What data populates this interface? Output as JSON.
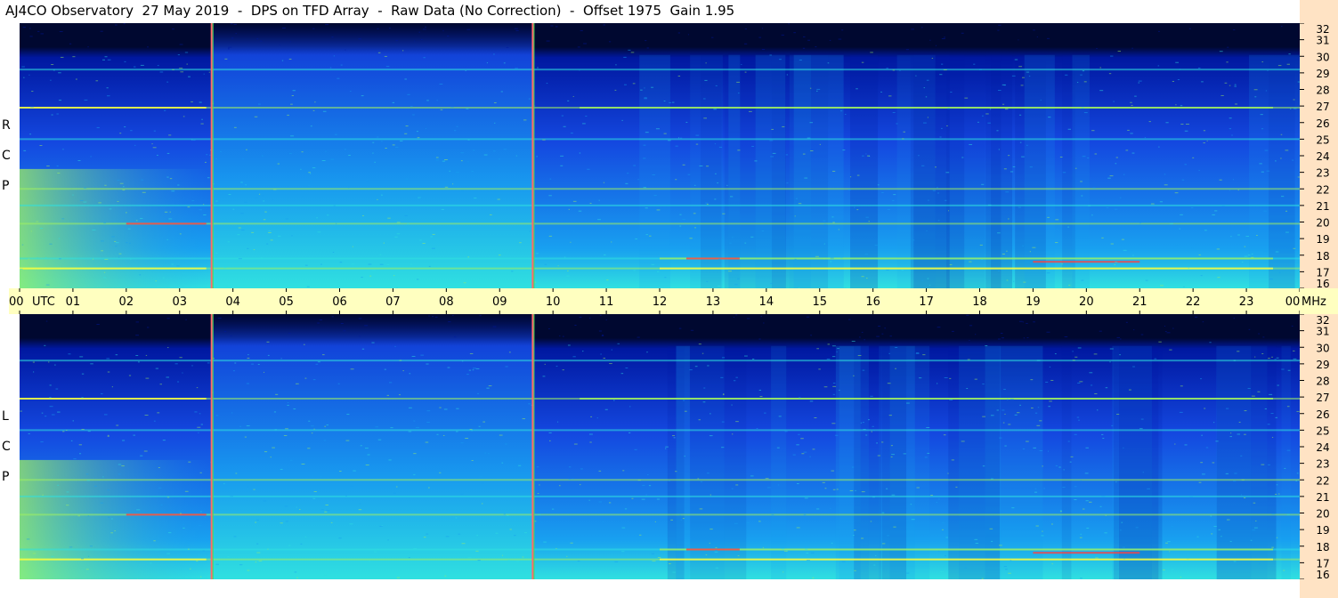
{
  "header": {
    "title": "AJ4CO Observatory  27 May 2019  -  DPS on TFD Array  -  Raw Data (No Correction)  -  Offset 1975  Gain 1.95"
  },
  "panels": {
    "rcp_label": [
      "R",
      "C",
      "P"
    ],
    "lcp_label": [
      "L",
      "C",
      "P"
    ]
  },
  "chart_data": {
    "type": "heatmap",
    "title": "AJ4CO Observatory  27 May 2019  -  DPS on TFD Array  -  Raw Data (No Correction)  -  Offset 1975  Gain 1.95",
    "x_ticks": [
      "00",
      "01",
      "02",
      "03",
      "04",
      "05",
      "06",
      "07",
      "08",
      "09",
      "10",
      "11",
      "12",
      "13",
      "14",
      "15",
      "16",
      "17",
      "18",
      "19",
      "20",
      "21",
      "22",
      "23",
      "00"
    ],
    "x_unit_label": "UTC",
    "y_ticks": [
      "16",
      "17",
      "18",
      "19",
      "20",
      "21",
      "22",
      "23",
      "24",
      "25",
      "26",
      "27",
      "28",
      "29",
      "30",
      "31",
      "32"
    ],
    "y_unit_label": "MHz",
    "ylim": [
      16,
      32
    ],
    "series": [
      {
        "name": "RCP"
      },
      {
        "name": "LCP"
      }
    ],
    "colormap": [
      "#000830",
      "#0018a0",
      "#1448e0",
      "#18a0f0",
      "#30e0e0",
      "#a0f060",
      "#ffff40",
      "#ff4040"
    ],
    "vertical_markers_utc": [
      3.6,
      9.62
    ],
    "interference_bands_mhz": [
      17.2,
      17.8,
      19.9,
      21.0,
      22.0,
      25.0,
      26.9,
      29.2
    ]
  }
}
